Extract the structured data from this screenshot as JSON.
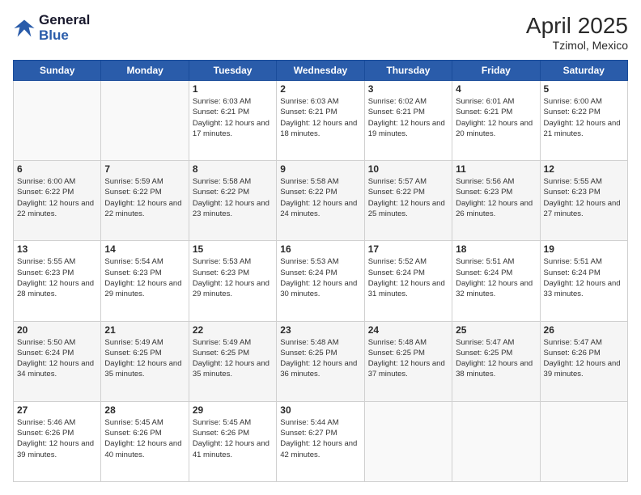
{
  "header": {
    "logo_line1": "General",
    "logo_line2": "Blue",
    "month_year": "April 2025",
    "location": "Tzimol, Mexico"
  },
  "weekdays": [
    "Sunday",
    "Monday",
    "Tuesday",
    "Wednesday",
    "Thursday",
    "Friday",
    "Saturday"
  ],
  "weeks": [
    [
      {
        "day": "",
        "info": ""
      },
      {
        "day": "",
        "info": ""
      },
      {
        "day": "1",
        "info": "Sunrise: 6:03 AM\nSunset: 6:21 PM\nDaylight: 12 hours and 17 minutes."
      },
      {
        "day": "2",
        "info": "Sunrise: 6:03 AM\nSunset: 6:21 PM\nDaylight: 12 hours and 18 minutes."
      },
      {
        "day": "3",
        "info": "Sunrise: 6:02 AM\nSunset: 6:21 PM\nDaylight: 12 hours and 19 minutes."
      },
      {
        "day": "4",
        "info": "Sunrise: 6:01 AM\nSunset: 6:21 PM\nDaylight: 12 hours and 20 minutes."
      },
      {
        "day": "5",
        "info": "Sunrise: 6:00 AM\nSunset: 6:22 PM\nDaylight: 12 hours and 21 minutes."
      }
    ],
    [
      {
        "day": "6",
        "info": "Sunrise: 6:00 AM\nSunset: 6:22 PM\nDaylight: 12 hours and 22 minutes."
      },
      {
        "day": "7",
        "info": "Sunrise: 5:59 AM\nSunset: 6:22 PM\nDaylight: 12 hours and 22 minutes."
      },
      {
        "day": "8",
        "info": "Sunrise: 5:58 AM\nSunset: 6:22 PM\nDaylight: 12 hours and 23 minutes."
      },
      {
        "day": "9",
        "info": "Sunrise: 5:58 AM\nSunset: 6:22 PM\nDaylight: 12 hours and 24 minutes."
      },
      {
        "day": "10",
        "info": "Sunrise: 5:57 AM\nSunset: 6:22 PM\nDaylight: 12 hours and 25 minutes."
      },
      {
        "day": "11",
        "info": "Sunrise: 5:56 AM\nSunset: 6:23 PM\nDaylight: 12 hours and 26 minutes."
      },
      {
        "day": "12",
        "info": "Sunrise: 5:55 AM\nSunset: 6:23 PM\nDaylight: 12 hours and 27 minutes."
      }
    ],
    [
      {
        "day": "13",
        "info": "Sunrise: 5:55 AM\nSunset: 6:23 PM\nDaylight: 12 hours and 28 minutes."
      },
      {
        "day": "14",
        "info": "Sunrise: 5:54 AM\nSunset: 6:23 PM\nDaylight: 12 hours and 29 minutes."
      },
      {
        "day": "15",
        "info": "Sunrise: 5:53 AM\nSunset: 6:23 PM\nDaylight: 12 hours and 29 minutes."
      },
      {
        "day": "16",
        "info": "Sunrise: 5:53 AM\nSunset: 6:24 PM\nDaylight: 12 hours and 30 minutes."
      },
      {
        "day": "17",
        "info": "Sunrise: 5:52 AM\nSunset: 6:24 PM\nDaylight: 12 hours and 31 minutes."
      },
      {
        "day": "18",
        "info": "Sunrise: 5:51 AM\nSunset: 6:24 PM\nDaylight: 12 hours and 32 minutes."
      },
      {
        "day": "19",
        "info": "Sunrise: 5:51 AM\nSunset: 6:24 PM\nDaylight: 12 hours and 33 minutes."
      }
    ],
    [
      {
        "day": "20",
        "info": "Sunrise: 5:50 AM\nSunset: 6:24 PM\nDaylight: 12 hours and 34 minutes."
      },
      {
        "day": "21",
        "info": "Sunrise: 5:49 AM\nSunset: 6:25 PM\nDaylight: 12 hours and 35 minutes."
      },
      {
        "day": "22",
        "info": "Sunrise: 5:49 AM\nSunset: 6:25 PM\nDaylight: 12 hours and 35 minutes."
      },
      {
        "day": "23",
        "info": "Sunrise: 5:48 AM\nSunset: 6:25 PM\nDaylight: 12 hours and 36 minutes."
      },
      {
        "day": "24",
        "info": "Sunrise: 5:48 AM\nSunset: 6:25 PM\nDaylight: 12 hours and 37 minutes."
      },
      {
        "day": "25",
        "info": "Sunrise: 5:47 AM\nSunset: 6:25 PM\nDaylight: 12 hours and 38 minutes."
      },
      {
        "day": "26",
        "info": "Sunrise: 5:47 AM\nSunset: 6:26 PM\nDaylight: 12 hours and 39 minutes."
      }
    ],
    [
      {
        "day": "27",
        "info": "Sunrise: 5:46 AM\nSunset: 6:26 PM\nDaylight: 12 hours and 39 minutes."
      },
      {
        "day": "28",
        "info": "Sunrise: 5:45 AM\nSunset: 6:26 PM\nDaylight: 12 hours and 40 minutes."
      },
      {
        "day": "29",
        "info": "Sunrise: 5:45 AM\nSunset: 6:26 PM\nDaylight: 12 hours and 41 minutes."
      },
      {
        "day": "30",
        "info": "Sunrise: 5:44 AM\nSunset: 6:27 PM\nDaylight: 12 hours and 42 minutes."
      },
      {
        "day": "",
        "info": ""
      },
      {
        "day": "",
        "info": ""
      },
      {
        "day": "",
        "info": ""
      }
    ]
  ]
}
